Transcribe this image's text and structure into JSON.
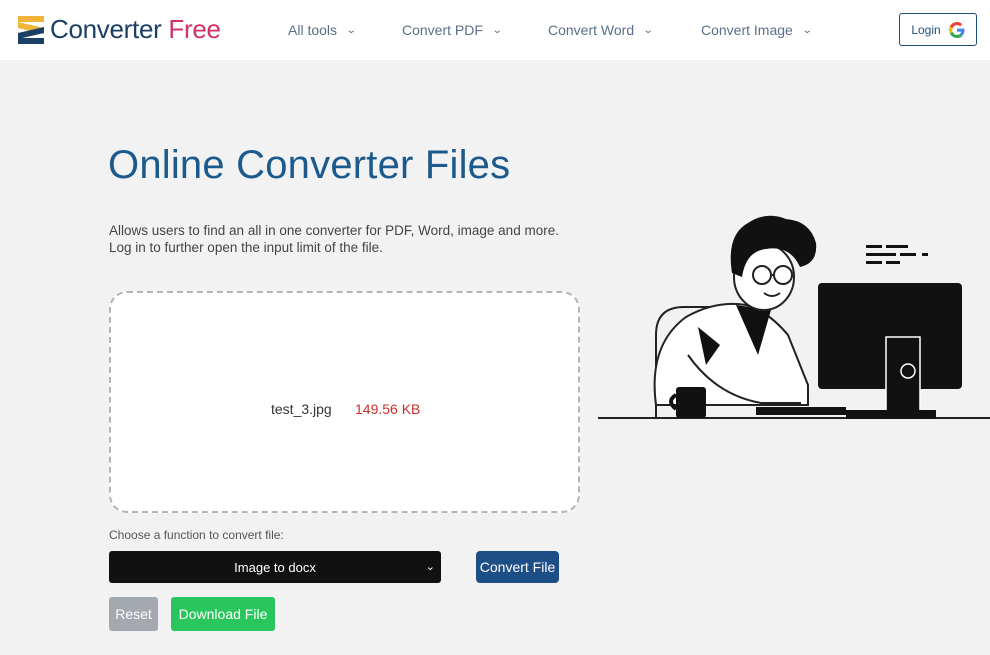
{
  "brand": {
    "name_part1": "Converter",
    "name_part2": "Free",
    "colors": {
      "primary": "#1c3f66",
      "accent": "#d1326a",
      "logo_yellow": "#f0b43a"
    }
  },
  "nav": {
    "items": [
      {
        "label": "All tools",
        "icon": "chevron-down-icon"
      },
      {
        "label": "Convert PDF",
        "icon": "chevron-down-icon"
      },
      {
        "label": "Convert Word",
        "icon": "chevron-down-icon"
      },
      {
        "label": "Convert Image",
        "icon": "chevron-down-icon"
      }
    ],
    "login": {
      "label": "Login",
      "icon": "google-icon"
    }
  },
  "hero": {
    "title": "Online Converter Files",
    "description": "Allows users to find an all in one converter for PDF, Word, image and more. Log in to further open the input limit of the file."
  },
  "upload": {
    "file_name": "test_3.jpg",
    "file_size": "149.56 KB"
  },
  "controls": {
    "choose_label": "Choose a function to convert file:",
    "selected_function": "Image to docx",
    "convert_label": "Convert File",
    "reset_label": "Reset",
    "download_label": "Download File",
    "colors": {
      "convert": "#1d4f86",
      "reset": "#a4a8af",
      "download": "#28c65c"
    }
  }
}
